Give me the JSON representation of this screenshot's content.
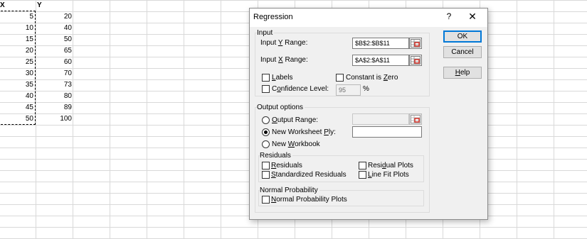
{
  "sheet": {
    "col_x_header": "X",
    "col_y_header": "Y",
    "x_values": [
      "5",
      "10",
      "15",
      "20",
      "25",
      "30",
      "35",
      "40",
      "45",
      "50"
    ],
    "y_values": [
      "20",
      "40",
      "50",
      "65",
      "60",
      "70",
      "73",
      "80",
      "89",
      "100"
    ]
  },
  "dialog": {
    "title": "Regression",
    "help_glyph": "?",
    "close_glyph": "✕",
    "input": {
      "group_label": "Input",
      "y_range_label": "Input Y Range:",
      "y_range_value": "$B$2:$B$11",
      "x_range_label": "Input X Range:",
      "x_range_value": "$A$2:$A$11",
      "labels_label": "Labels",
      "constant_zero_label": "Constant is Zero",
      "confidence_label": "Confidence Level:",
      "confidence_value": "95",
      "percent_sign": "%"
    },
    "output": {
      "group_label": "Output options",
      "output_range_label": "Output Range:",
      "new_ply_label": "New Worksheet Ply:",
      "new_workbook_label": "New Workbook",
      "selected_option": "New Worksheet Ply"
    },
    "residuals": {
      "group_label": "Residuals",
      "residuals_label": "Residuals",
      "standardized_label": "Standardized Residuals",
      "residual_plots_label": "Residual Plots",
      "line_fit_label": "Line Fit Plots"
    },
    "normal_probability": {
      "group_label": "Normal Probability",
      "plots_label": "Normal Probability Plots"
    },
    "buttons": {
      "ok": "OK",
      "cancel": "Cancel",
      "help": "Help"
    }
  }
}
